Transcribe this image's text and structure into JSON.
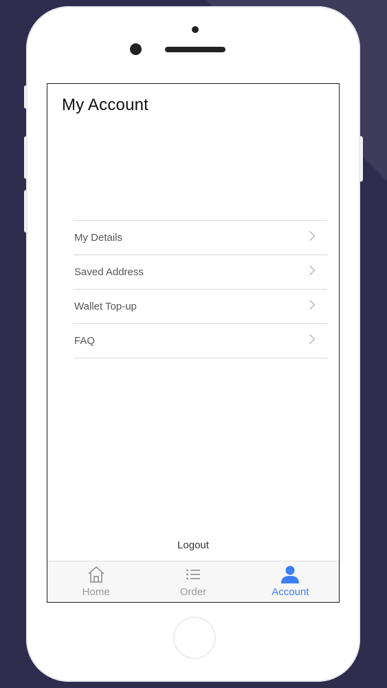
{
  "screen": {
    "title": "My Account"
  },
  "menu": {
    "items": [
      {
        "label": "My Details"
      },
      {
        "label": "Saved Address"
      },
      {
        "label": "Wallet Top-up"
      },
      {
        "label": "FAQ"
      }
    ]
  },
  "logout": {
    "label": "Logout"
  },
  "tabbar": {
    "tabs": [
      {
        "label": "Home",
        "icon": "home-icon"
      },
      {
        "label": "Order",
        "icon": "list-icon"
      },
      {
        "label": "Account",
        "icon": "user-icon",
        "active": true
      }
    ],
    "active_color": "#3b7ff2",
    "inactive_color": "#999999"
  }
}
